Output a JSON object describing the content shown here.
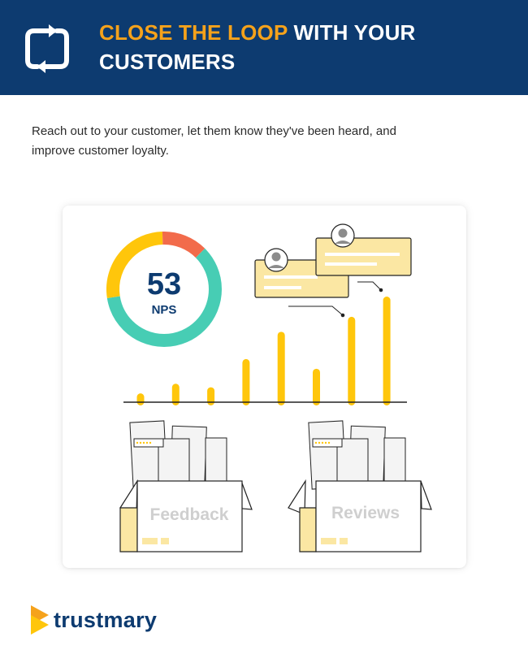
{
  "header": {
    "title_accent": "CLOSE THE LOOP",
    "title_rest": " WITH YOUR CUSTOMERS",
    "icon": "loop-arrows-icon"
  },
  "intro": {
    "text": "Reach out to your customer, let them know they've been heard, and improve customer loyalty."
  },
  "nps": {
    "value": "53",
    "label": "NPS",
    "segments": [
      {
        "share": 0.6,
        "color": "#47cdb4"
      },
      {
        "share": 0.27,
        "color": "#ffc60b"
      },
      {
        "share": 0.13,
        "color": "#f26b4b"
      }
    ]
  },
  "bars": {
    "color": "#ffc60b",
    "values": [
      10,
      21,
      17,
      49,
      80,
      38,
      97,
      120
    ]
  },
  "boxes": {
    "feedback_label": "Feedback",
    "reviews_label": "Reviews"
  },
  "brand": {
    "name": "trustmary",
    "colors": {
      "navy": "#0d3b70",
      "orange": "#f5a21b",
      "yellow": "#ffc60b",
      "teal": "#47cdb4",
      "coral": "#f26b4b"
    }
  }
}
